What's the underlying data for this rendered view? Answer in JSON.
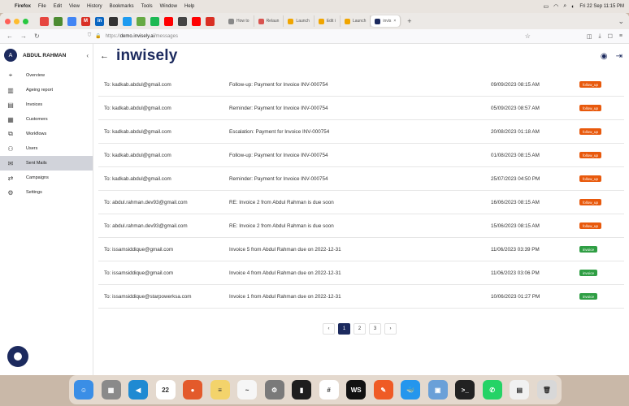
{
  "menubar": {
    "items": [
      "Firefox",
      "File",
      "Edit",
      "View",
      "History",
      "Bookmarks",
      "Tools",
      "Window",
      "Help"
    ],
    "datetime": "Fri 22 Sep  11:15 PM"
  },
  "browser": {
    "tabs": [
      {
        "label": "How to"
      },
      {
        "label": "Relaun"
      },
      {
        "label": "Launch"
      },
      {
        "label": "Edit i"
      },
      {
        "label": "Launch"
      },
      {
        "label": "invis"
      }
    ],
    "url_prefix": "https://",
    "url_host": "demo.invisely.ai",
    "url_path": "/messages"
  },
  "sidebar": {
    "avatar_initial": "A",
    "user_name": "ABDUL RAHMAN",
    "items": [
      {
        "label": "Overview",
        "icon": "binoculars-icon"
      },
      {
        "label": "Ageing report",
        "icon": "bar-chart-icon"
      },
      {
        "label": "Invoices",
        "icon": "invoice-icon"
      },
      {
        "label": "Customers",
        "icon": "building-icon"
      },
      {
        "label": "Workflows",
        "icon": "sitemap-icon"
      },
      {
        "label": "Users",
        "icon": "users-icon"
      },
      {
        "label": "Sent Mails",
        "icon": "mail-icon"
      },
      {
        "label": "Campaigns",
        "icon": "campaign-icon"
      },
      {
        "label": "Settings",
        "icon": "gear-icon"
      }
    ]
  },
  "header": {
    "logo": "inwisely"
  },
  "messages": [
    {
      "to": "To: kadkab.abdul@gmail.com",
      "subject": "Follow-up: Payment for Invoice INV-000754",
      "date": "09/09/2023 08:15 AM",
      "tag": "follow_up",
      "color": "#e8590c"
    },
    {
      "to": "To: kadkab.abdul@gmail.com",
      "subject": "Reminder: Payment for Invoice INV-000754",
      "date": "05/09/2023 08:57 AM",
      "tag": "follow_up",
      "color": "#e8590c"
    },
    {
      "to": "To: kadkab.abdul@gmail.com",
      "subject": "Escalation: Payment for Invoice INV-000754",
      "date": "20/08/2023 01:18 AM",
      "tag": "follow_up",
      "color": "#e8590c"
    },
    {
      "to": "To: kadkab.abdul@gmail.com",
      "subject": "Follow-up: Payment for Invoice INV-000754",
      "date": "01/08/2023 08:15 AM",
      "tag": "follow_up",
      "color": "#e8590c"
    },
    {
      "to": "To: kadkab.abdul@gmail.com",
      "subject": "Reminder: Payment for Invoice INV-000754",
      "date": "25/07/2023 04:50 PM",
      "tag": "follow_up",
      "color": "#e8590c"
    },
    {
      "to": "To: abdul.rahman.dev93@gmail.com",
      "subject": "RE: Invoice 2 from Abdul Rahman is due soon",
      "date": "16/06/2023 08:15 AM",
      "tag": "follow_up",
      "color": "#e8590c"
    },
    {
      "to": "To: abdul.rahman.dev93@gmail.com",
      "subject": "RE: Invoice 2 from Abdul Rahman is due soon",
      "date": "15/06/2023 08:15 AM",
      "tag": "follow_up",
      "color": "#e8590c"
    },
    {
      "to": "To: issamsiddique@gmail.com",
      "subject": "Invoice 5 from Abdul Rahman due on 2022-12-31",
      "date": "11/06/2023 03:39 PM",
      "tag": "invoice",
      "color": "#2f9e44"
    },
    {
      "to": "To: issamsiddique@gmail.com",
      "subject": "Invoice 4 from Abdul Rahman due on 2022-12-31",
      "date": "11/06/2023 03:06 PM",
      "tag": "invoice",
      "color": "#2f9e44"
    },
    {
      "to": "To: issamsiddique@starpowerksa.com",
      "subject": "Invoice 1 from Abdul Rahman due on 2022-12-31",
      "date": "10/06/2023 01:27 PM",
      "tag": "invoice",
      "color": "#2f9e44"
    }
  ],
  "pagination": {
    "prev": "‹",
    "pages": [
      "1",
      "2",
      "3"
    ],
    "next": "›",
    "current": "1"
  },
  "dock": {
    "apps": [
      {
        "name": "finder-icon",
        "color": "#3a8ee6",
        "glyph": "☺"
      },
      {
        "name": "launchpad-icon",
        "color": "#8a8a8a",
        "glyph": "▦"
      },
      {
        "name": "vscode-icon",
        "color": "#1f8ad2",
        "glyph": "◀"
      },
      {
        "name": "calendar-icon",
        "color": "#ffffff",
        "glyph": "22"
      },
      {
        "name": "firefox-icon",
        "color": "#e35a2b",
        "glyph": "●"
      },
      {
        "name": "notes-icon",
        "color": "#f3d36b",
        "glyph": "≡"
      },
      {
        "name": "freeform-icon",
        "color": "#f6f6f6",
        "glyph": "~"
      },
      {
        "name": "system-settings-icon",
        "color": "#7a7a7a",
        "glyph": "⚙"
      },
      {
        "name": "terminal-icon",
        "color": "#1e1e1e",
        "glyph": "▮"
      },
      {
        "name": "slack-icon",
        "color": "#ffffff",
        "glyph": "#"
      },
      {
        "name": "webstorm-icon",
        "color": "#111111",
        "glyph": "WS"
      },
      {
        "name": "postman-icon",
        "color": "#ef5b25",
        "glyph": "✎"
      },
      {
        "name": "docker-icon",
        "color": "#2496ed",
        "glyph": "🐳"
      },
      {
        "name": "preview-icon",
        "color": "#6aa0d8",
        "glyph": "▣"
      },
      {
        "name": "terminal2-icon",
        "color": "#222222",
        "glyph": ">_"
      },
      {
        "name": "whatsapp-icon",
        "color": "#25d366",
        "glyph": "✆"
      },
      {
        "name": "downloads-icon",
        "color": "#f1f1f1",
        "glyph": "▤"
      },
      {
        "name": "trash-icon",
        "color": "#d8d8d8",
        "glyph": "🗑"
      }
    ]
  }
}
